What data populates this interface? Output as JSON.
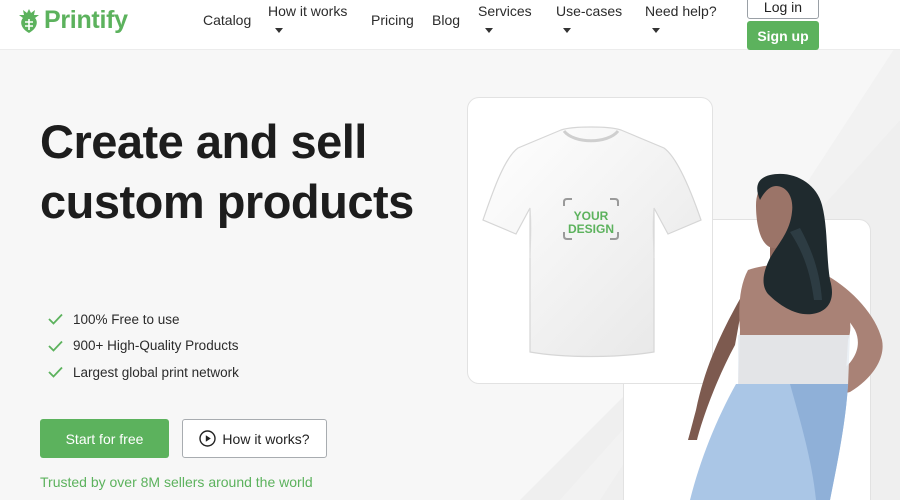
{
  "brand": {
    "name": "Printify",
    "accent": "#5cb25d"
  },
  "nav": {
    "items": [
      {
        "label": "Catalog",
        "dropdown": false
      },
      {
        "label": "How it works",
        "dropdown": true
      },
      {
        "label": "Pricing",
        "dropdown": false
      },
      {
        "label": "Blog",
        "dropdown": false
      },
      {
        "label": "Services",
        "dropdown": true
      },
      {
        "label": "Use-cases",
        "dropdown": true
      },
      {
        "label": "Need help?",
        "dropdown": true
      }
    ],
    "login_label": "Log in",
    "signup_label": "Sign up"
  },
  "hero": {
    "title": "Create and sell custom products",
    "features": [
      "100% Free to use",
      "900+ High-Quality Products",
      "Largest global print network"
    ],
    "primary_cta": "Start for free",
    "secondary_cta": "How it works?",
    "trusted_text": "Trusted by over 8M sellers around the world"
  },
  "product_card": {
    "design_placeholder": "YOUR DESIGN"
  },
  "icons": {
    "logo": "printify-logo-icon",
    "check": "check-icon",
    "play": "play-circle-icon",
    "caret": "chevron-down-icon"
  }
}
